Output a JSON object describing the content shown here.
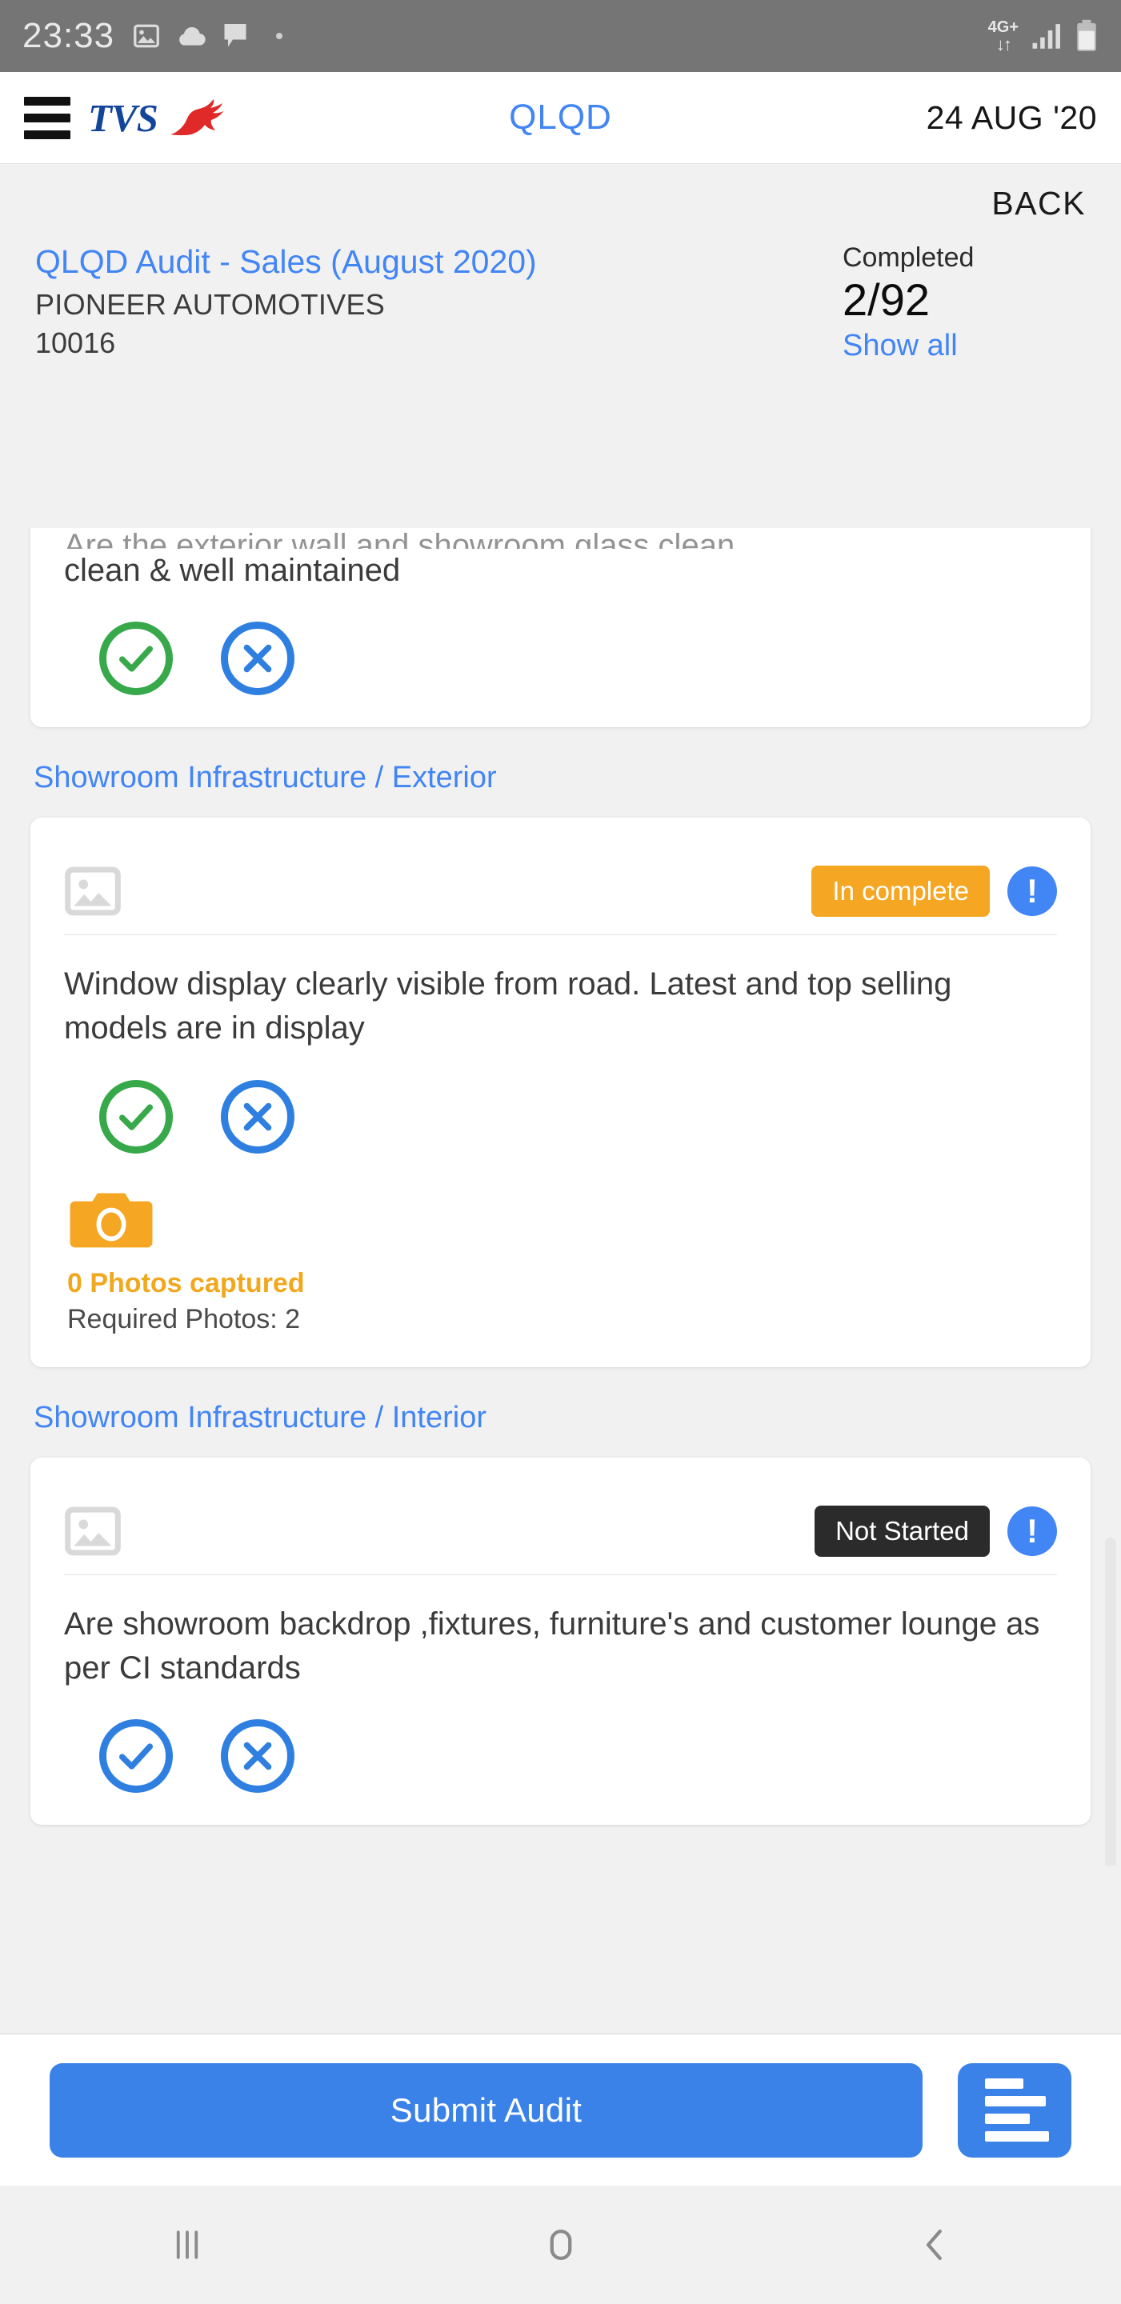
{
  "status_bar": {
    "time": "23:33",
    "icons": [
      "image-icon",
      "cloud-icon",
      "message-icon",
      "dot-icon"
    ],
    "network_label": "4G+",
    "network_arrows": "↓↑",
    "signal": "signal-bars-icon",
    "battery": "battery-icon"
  },
  "app_bar": {
    "menu": "hamburger-menu-icon",
    "brand": "TVS",
    "brand_mark": "tvs-horse-logo",
    "title": "QLQD",
    "date": "24 AUG '20"
  },
  "header": {
    "back_label": "BACK",
    "audit_title": "QLQD Audit  - Sales (August 2020)",
    "dealer_name": "PIONEER AUTOMOTIVES",
    "dealer_code": "10016",
    "completed_label": "Completed",
    "completed_value": "2/92",
    "show_all_label": "Show all"
  },
  "colors": {
    "accent_blue": "#4285f4",
    "button_blue": "#3b82e8",
    "green": "#37a94a",
    "orange": "#f5a623",
    "photo_orange": "#f0a81f",
    "dark_badge": "#2b2b2b"
  },
  "cards": [
    {
      "clipped": true,
      "question_clipped_line": "Are the exterior wall and showroom glass clean,",
      "question": "clean & well maintained",
      "answers": [
        {
          "type": "check-icon",
          "state": "green"
        },
        {
          "type": "cross-icon",
          "state": "blue"
        }
      ]
    },
    {
      "section": "Showroom Infrastructure / Exterior",
      "image_placeholder": "image-placeholder-icon",
      "badge_label": "In complete",
      "badge_style": "incomplete",
      "info_icon": "info-exclamation-icon",
      "question": "Window display clearly visible from road. Latest and top selling models are in display",
      "answers": [
        {
          "type": "check-icon",
          "state": "green"
        },
        {
          "type": "cross-icon",
          "state": "blue"
        }
      ],
      "photo": {
        "camera_icon": "camera-icon",
        "captured_label": "0 Photos captured",
        "required_label": "Required Photos: 2"
      }
    },
    {
      "section": "Showroom Infrastructure / Interior",
      "image_placeholder": "image-placeholder-icon",
      "badge_label": "Not Started",
      "badge_style": "notstarted",
      "info_icon": "info-exclamation-icon",
      "question": "Are showroom backdrop ,fixtures, furniture's  and customer lounge as per CI standards",
      "answers": [
        {
          "type": "check-icon",
          "state": "blue"
        },
        {
          "type": "cross-icon",
          "state": "blue"
        }
      ]
    }
  ],
  "action_bar": {
    "submit_label": "Submit Audit",
    "notes_icon": "notes-list-icon"
  },
  "nav_bar": {
    "recents": "recents-icon",
    "home": "home-icon",
    "back": "back-chevron-icon"
  }
}
